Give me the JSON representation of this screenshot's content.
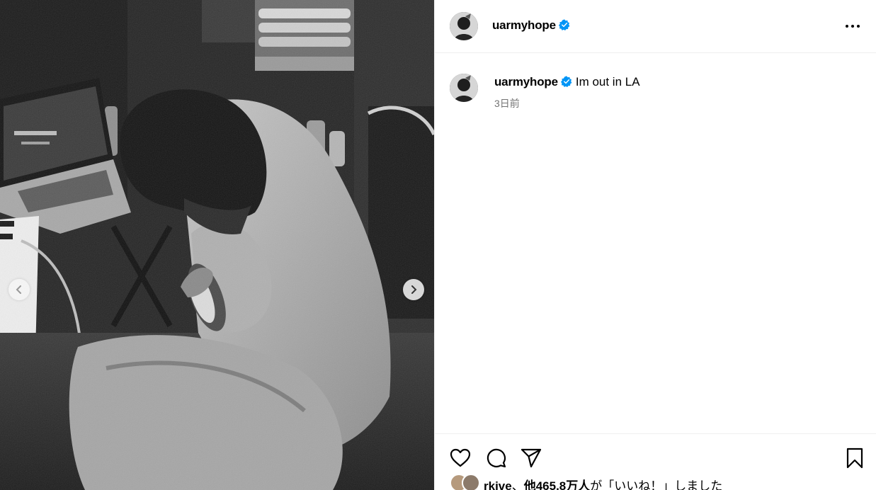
{
  "post": {
    "username": "uarmyhope",
    "caption": "Im out in LA",
    "timestamp": "3日前"
  },
  "likes": {
    "user": "rkive",
    "others": "他465.8万人",
    "suffix": "が「いいね！」しました"
  },
  "icons": {
    "verified": "verified-badge-icon",
    "more": "more-options-icon",
    "like": "heart-icon",
    "comment": "comment-icon",
    "share": "send-icon",
    "save": "bookmark-icon",
    "prev": "chevron-left-icon",
    "next": "chevron-right-icon"
  },
  "colors": {
    "verified": "#0095f6",
    "timestamp": "#737373",
    "divider": "#efefef"
  }
}
